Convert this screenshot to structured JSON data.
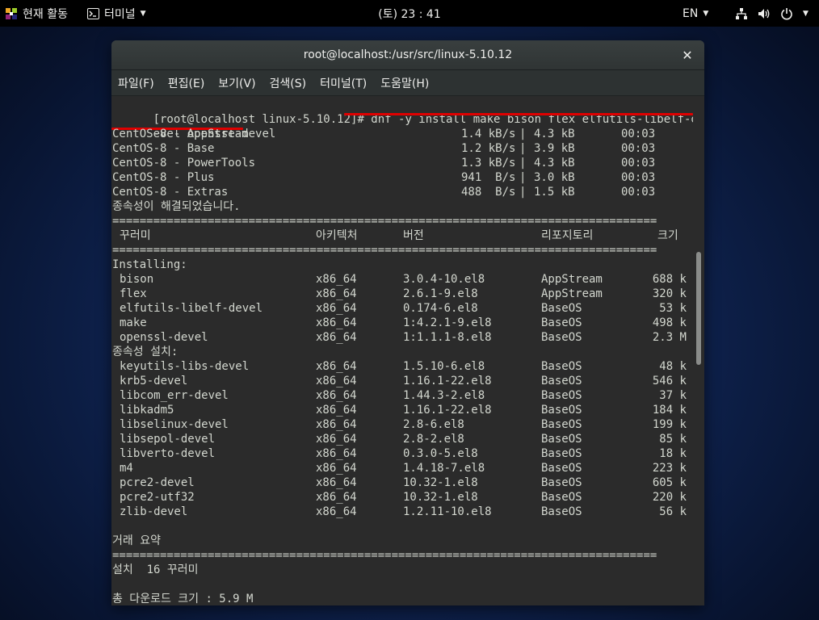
{
  "topbar": {
    "activities_label": "현재 활동",
    "app_label": "터미널",
    "clock": "(토) 23 : 41",
    "language": "EN"
  },
  "window": {
    "title": "root@localhost:/usr/src/linux-5.10.12",
    "menu": [
      "파일(F)",
      "편집(E)",
      "보기(V)",
      "검색(S)",
      "터미널(T)",
      "도움말(H)"
    ]
  },
  "terminal": {
    "prompt": "[root@localhost linux-5.10.12]# ",
    "command_part1": "dnf -y install make bison flex elfutils-libelf-d",
    "command_part2": "evel openssl-devel",
    "repos": [
      {
        "name": "CentOS-8 - AppStream",
        "speed": "1.4 kB/s",
        "size": "4.3 kB",
        "time": "00:03"
      },
      {
        "name": "CentOS-8 - Base",
        "speed": "1.2 kB/s",
        "size": "3.9 kB",
        "time": "00:03"
      },
      {
        "name": "CentOS-8 - PowerTools",
        "speed": "1.3 kB/s",
        "size": "4.3 kB",
        "time": "00:03"
      },
      {
        "name": "CentOS-8 - Plus",
        "speed": "941  B/s",
        "size": "3.0 kB",
        "time": "00:03"
      },
      {
        "name": "CentOS-8 - Extras",
        "speed": "488  B/s",
        "size": "1.5 kB",
        "time": "00:03"
      }
    ],
    "resolved": "종속성이 해결되었습니다.",
    "separator": "================================================================================",
    "headers": {
      "package": "꾸러미",
      "arch": "아키텍처",
      "version": "버전",
      "repo": "리포지토리",
      "size": "크기"
    },
    "installing_label": "Installing:",
    "installing": [
      {
        "name": "bison",
        "arch": "x86_64",
        "version": "3.0.4-10.el8",
        "repo": "AppStream",
        "size": "688 k"
      },
      {
        "name": "flex",
        "arch": "x86_64",
        "version": "2.6.1-9.el8",
        "repo": "AppStream",
        "size": "320 k"
      },
      {
        "name": "elfutils-libelf-devel",
        "arch": "x86_64",
        "version": "0.174-6.el8",
        "repo": "BaseOS",
        "size": "53 k"
      },
      {
        "name": "make",
        "arch": "x86_64",
        "version": "1:4.2.1-9.el8",
        "repo": "BaseOS",
        "size": "498 k"
      },
      {
        "name": "openssl-devel",
        "arch": "x86_64",
        "version": "1:1.1.1-8.el8",
        "repo": "BaseOS",
        "size": "2.3 M"
      }
    ],
    "deps_label": "종속성 설치:",
    "deps": [
      {
        "name": "keyutils-libs-devel",
        "arch": "x86_64",
        "version": "1.5.10-6.el8",
        "repo": "BaseOS",
        "size": "48 k"
      },
      {
        "name": "krb5-devel",
        "arch": "x86_64",
        "version": "1.16.1-22.el8",
        "repo": "BaseOS",
        "size": "546 k"
      },
      {
        "name": "libcom_err-devel",
        "arch": "x86_64",
        "version": "1.44.3-2.el8",
        "repo": "BaseOS",
        "size": "37 k"
      },
      {
        "name": "libkadm5",
        "arch": "x86_64",
        "version": "1.16.1-22.el8",
        "repo": "BaseOS",
        "size": "184 k"
      },
      {
        "name": "libselinux-devel",
        "arch": "x86_64",
        "version": "2.8-6.el8",
        "repo": "BaseOS",
        "size": "199 k"
      },
      {
        "name": "libsepol-devel",
        "arch": "x86_64",
        "version": "2.8-2.el8",
        "repo": "BaseOS",
        "size": "85 k"
      },
      {
        "name": "libverto-devel",
        "arch": "x86_64",
        "version": "0.3.0-5.el8",
        "repo": "BaseOS",
        "size": "18 k"
      },
      {
        "name": "m4",
        "arch": "x86_64",
        "version": "1.4.18-7.el8",
        "repo": "BaseOS",
        "size": "223 k"
      },
      {
        "name": "pcre2-devel",
        "arch": "x86_64",
        "version": "10.32-1.el8",
        "repo": "BaseOS",
        "size": "605 k"
      },
      {
        "name": "pcre2-utf32",
        "arch": "x86_64",
        "version": "10.32-1.el8",
        "repo": "BaseOS",
        "size": "220 k"
      },
      {
        "name": "zlib-devel",
        "arch": "x86_64",
        "version": "1.2.11-10.el8",
        "repo": "BaseOS",
        "size": "56 k"
      }
    ],
    "summary_label": "거래 요약",
    "install_count": "설치  16 꾸러미",
    "download_size": "총 다운로드 크기 : 5.9 M"
  },
  "colors": {
    "terminal_bg": "#2b2b2b",
    "terminal_fg": "#d3d7cf",
    "highlight_underline": "#e00000"
  },
  "icons": [
    "centos-logo-icon",
    "terminal-app-icon",
    "chevron-down-icon",
    "network-icon",
    "volume-icon",
    "power-icon",
    "close-icon"
  ]
}
